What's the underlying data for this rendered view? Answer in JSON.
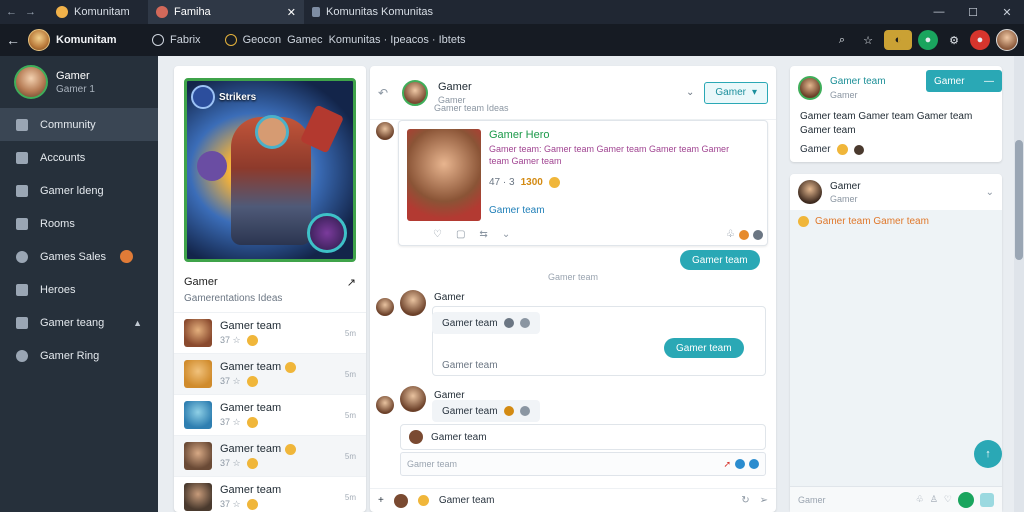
{
  "titlebar": {
    "nav_back": "←",
    "nav_forward": "→",
    "tabs": [
      {
        "label": "Komunitam"
      },
      {
        "label": "Famiha",
        "close": "✕"
      },
      {
        "label": "Komunitas Komunitas"
      }
    ],
    "minimize": "—",
    "maximize": "☐",
    "close": "✕"
  },
  "toolbar": {
    "back": "←",
    "brand": "Komunitam",
    "address": [
      "Fabrix",
      "Geocon",
      "Gamec",
      "Komunitas · Ipeacos · Ibtets"
    ],
    "right_icons": [
      "search-icon",
      "star-icon",
      "sticker-icon",
      "green-icon",
      "gear-icon",
      "red-icon",
      "avatar"
    ]
  },
  "sidebar": {
    "profile_name": "Gamer",
    "profile_sub": "Gamer 1",
    "items": [
      {
        "label": "Community",
        "icon": "community-icon",
        "active": true
      },
      {
        "label": "Accounts",
        "icon": "accounts-icon"
      },
      {
        "label": "Gamer ldeng",
        "icon": "chat-icon"
      },
      {
        "label": "Rooms",
        "icon": "rooms-icon"
      },
      {
        "label": "Games Sales",
        "icon": "games-icon",
        "emoji": true
      },
      {
        "label": "Heroes",
        "icon": "heroes-icon"
      },
      {
        "label": "Gamer teang",
        "icon": "gamer-icon",
        "caret": "▲"
      },
      {
        "label": "Gamer Ring",
        "icon": "ring-icon"
      }
    ]
  },
  "left_panel": {
    "hero_badge": "Strikers",
    "title": "Gamer",
    "title_icon": "↗",
    "subtitle": "Gamerentations Ideas",
    "list": [
      {
        "name": "Gamer team",
        "meta": "37 ☆",
        "time": "5m",
        "thumb": "#8a4a2e",
        "alt": false
      },
      {
        "name": "Gamer team",
        "meta": "37 ☆",
        "time": "5m",
        "thumb": "#d08b2c",
        "alt": true
      },
      {
        "name": "Gamer team",
        "meta": "37 ☆",
        "time": "5m",
        "thumb": "#2f7fb1",
        "alt": false
      },
      {
        "name": "Gamer team",
        "meta": "37 ☆",
        "time": "5m",
        "thumb": "#6a4a36",
        "alt": true
      },
      {
        "name": "Gamer team",
        "meta": "37 ☆",
        "time": "5m",
        "thumb": "#4a3a2e",
        "alt": false
      }
    ]
  },
  "chat": {
    "header_title": "Gamer",
    "header_sub": "Gamer",
    "header_sub2": "Gamer team Ideas",
    "header_button": "Gamer",
    "card": {
      "name": "Gamer Hero",
      "desc": "Gamer team: Gamer team Gamer team Gamer team Gamer team Gamer team",
      "stats_prefix": "47 · 3",
      "stats_highlight": "1300",
      "link": "Gamer team"
    },
    "pill1": "Gamer team",
    "separator": "Gamer team",
    "msg1_name": "Gamer",
    "msg1_bubble": "Gamer team",
    "msg1_pill": "Gamer team",
    "msg1_box": "Gamer team",
    "msg2_name": "Gamer",
    "msg2_bubble": "Gamer team",
    "msg2_reply": "Gamer team",
    "input_placeholder": "Gamer team",
    "footer_text": "Gamer team"
  },
  "right": {
    "card_name": "Gamer team",
    "card_sub": "Gamer",
    "card_button": "Gamer",
    "card_body": "Gamer team Gamer team Gamer team Gamer team",
    "card_foot": "Gamer",
    "panel_name": "Gamer",
    "panel_sub": "Gamer",
    "panel_line": "Gamer team Gamer team",
    "fab": "↑",
    "input_placeholder": "Gamer"
  }
}
